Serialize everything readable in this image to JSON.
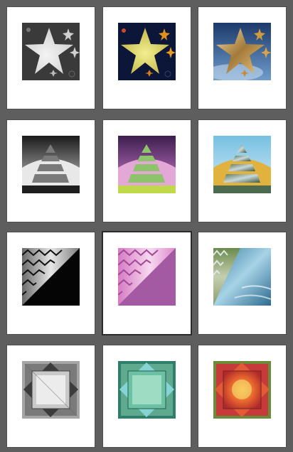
{
  "grid": {
    "rows": 4,
    "columns": 3,
    "selected_index": 7
  },
  "thumbnails": [
    {
      "name": "star-grayscale",
      "shape": "star"
    },
    {
      "name": "star-colored",
      "shape": "star"
    },
    {
      "name": "star-photo",
      "shape": "star"
    },
    {
      "name": "pyramid-grayscale",
      "shape": "pyramid"
    },
    {
      "name": "pyramid-colored",
      "shape": "pyramid"
    },
    {
      "name": "pyramid-photo",
      "shape": "pyramid"
    },
    {
      "name": "zigzag-grayscale",
      "shape": "zigzag"
    },
    {
      "name": "zigzag-colored",
      "shape": "zigzag"
    },
    {
      "name": "zigzag-photo",
      "shape": "zigzag"
    },
    {
      "name": "squares-grayscale",
      "shape": "squares"
    },
    {
      "name": "squares-colored",
      "shape": "squares"
    },
    {
      "name": "squares-photo",
      "shape": "squares"
    }
  ],
  "colors": {
    "background": "#5e5e5e",
    "card": "#ffffff"
  }
}
